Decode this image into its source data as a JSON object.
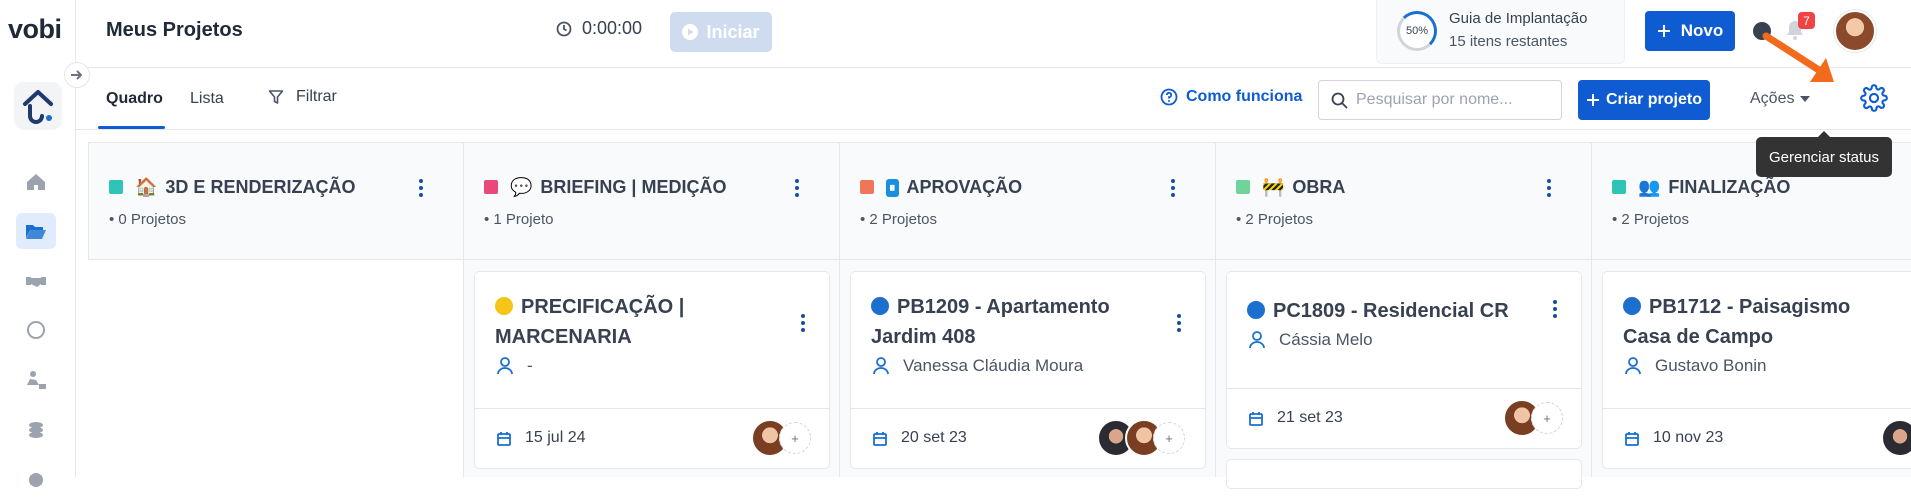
{
  "app": {
    "logo_text": "vobi"
  },
  "header": {
    "title": "Meus Projetos",
    "timer": "0:00:00",
    "start_label": "Iniciar",
    "guide_percent": "50%",
    "guide_title": "Guia de Implantação",
    "guide_subtitle": "15 itens restantes",
    "new_label": "Novo",
    "notification_count": "7"
  },
  "toolbar": {
    "tabs": [
      {
        "label": "Quadro",
        "active": true
      },
      {
        "label": "Lista",
        "active": false
      }
    ],
    "filter_label": "Filtrar",
    "howto_label": "Como funciona",
    "search_placeholder": "Pesquisar por nome...",
    "create_label": "Criar projeto",
    "actions_label": "Ações",
    "tooltip": "Gerenciar status"
  },
  "sidebar": {
    "items": [
      {
        "icon": "home-icon"
      },
      {
        "icon": "folder-open-icon",
        "active": true
      },
      {
        "icon": "handshake-icon"
      },
      {
        "icon": "compass-icon"
      },
      {
        "icon": "worker-icon"
      },
      {
        "icon": "coins-icon"
      }
    ]
  },
  "columns": [
    {
      "title": "3D E RENDERIZAÇÃO",
      "emoji": "🏠",
      "color": "#2ec4b6",
      "count": "0 Projetos",
      "cards": []
    },
    {
      "title": "BRIEFING | MEDIÇÃO",
      "emoji": "💬",
      "color": "#e8487a",
      "count": "1 Projeto",
      "cards": [
        {
          "title": "PRECIFICAÇÃO | MARCENARIA",
          "dot": "#f5c518",
          "person": "-",
          "date": "15 jul 24",
          "avatars": [
            "w"
          ]
        }
      ]
    },
    {
      "title": "APROVAÇÃO",
      "emoji": "⏸",
      "color": "#f0765a",
      "count": "2 Projetos",
      "cards": [
        {
          "title": "PB1209 - Apartamento Jardim 408",
          "dot": "#1a6fcf",
          "person": "Vanessa Cláudia Moura",
          "date": "20 set 23",
          "avatars": [
            "m",
            "w"
          ]
        }
      ]
    },
    {
      "title": "OBRA",
      "emoji": "🚧",
      "color": "#6fd39a",
      "count": "2 Projetos",
      "cards": [
        {
          "title": "PC1809 - Residencial CR",
          "dot": "#1a6fcf",
          "person": "Cássia Melo",
          "date": "21 set 23",
          "avatars": [
            "w"
          ]
        }
      ]
    },
    {
      "title": "FINALIZAÇÃO",
      "emoji": "👥",
      "color": "#2ec4b6",
      "count": "2 Projetos",
      "cards": [
        {
          "title": "PB1712 - Paisagismo Casa de Campo",
          "dot": "#1a6fcf",
          "person": "Gustavo Bonin",
          "date": "10 nov 23",
          "avatars": [
            "m"
          ]
        }
      ]
    }
  ]
}
